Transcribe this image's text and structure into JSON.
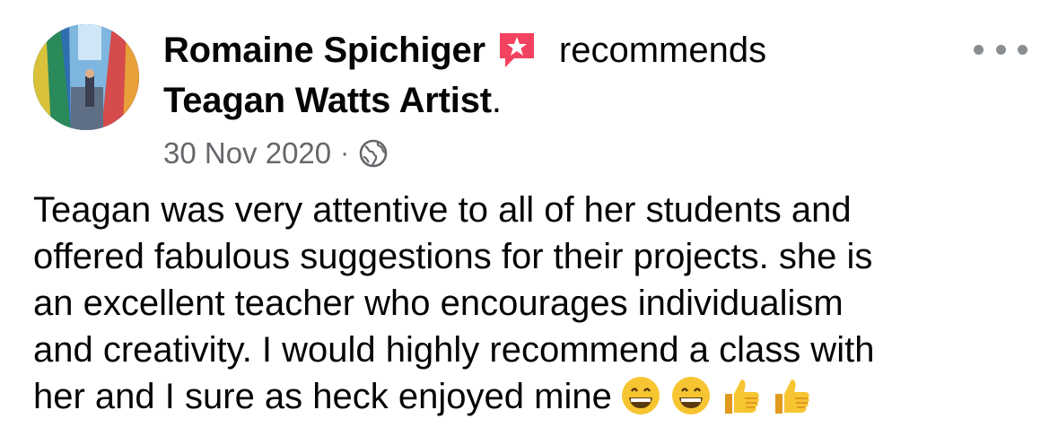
{
  "post": {
    "author": "Romaine Spichiger",
    "action": "recommends",
    "page_name": "Teagan Watts Artist",
    "page_suffix": ".",
    "date": "30 Nov 2020",
    "separator": "·",
    "privacy_icon": "globe-icon",
    "recommend_icon": "recommendation-star-icon",
    "more_icon": "more-options-icon",
    "text_lines": [
      "Teagan was very attentive to all of her students and",
      "offered fabulous suggestions for their projects. she is",
      "an excellent teacher who encourages individualism",
      "and creativity. I would highly recommend a class with",
      "her and I sure as heck enjoyed mine"
    ],
    "emojis": [
      "😁",
      "😁",
      "👍",
      "👍"
    ]
  },
  "colors": {
    "recommend_badge": "#f3425f",
    "secondary_text": "#65676b",
    "primary_text": "#050505"
  }
}
